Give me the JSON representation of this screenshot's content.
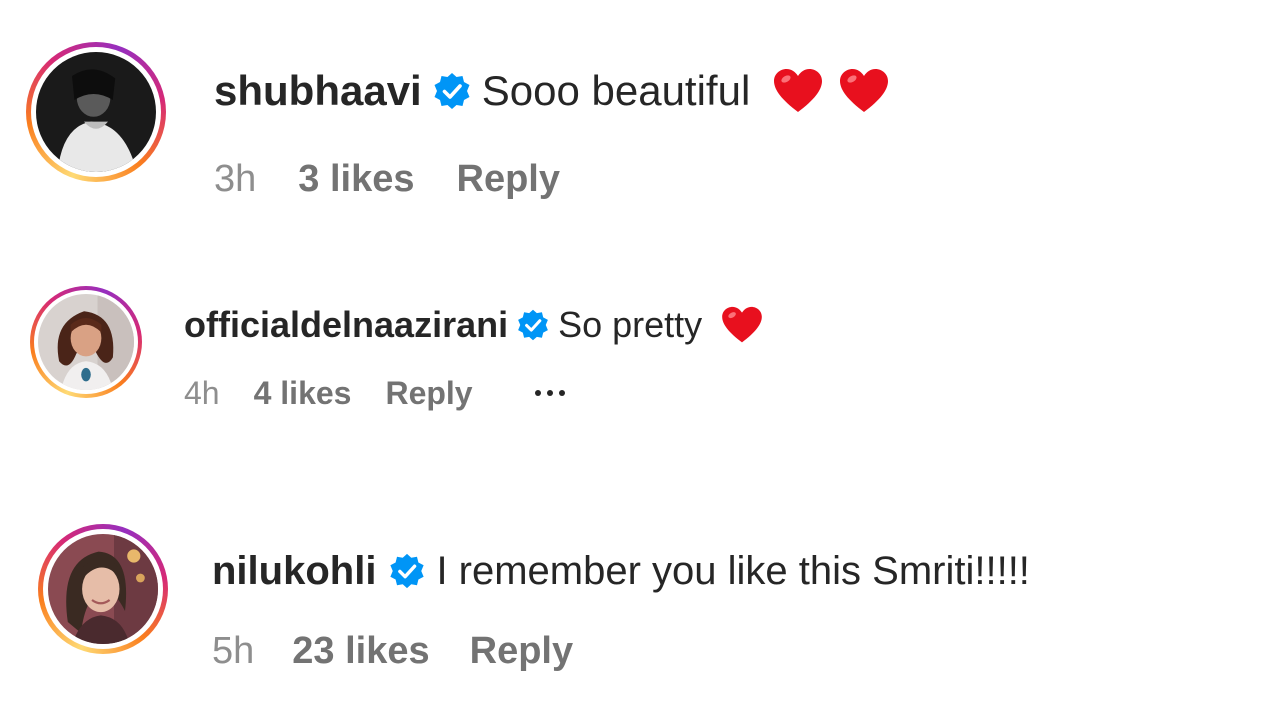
{
  "comments": [
    {
      "username": "shubhaavi",
      "text": "Sooo beautiful",
      "hearts": 2,
      "time": "3h",
      "likes": "3 likes",
      "reply": "Reply",
      "verified": true
    },
    {
      "username": "officialdelnaazirani",
      "text": "So pretty",
      "hearts": 1,
      "time": "4h",
      "likes": "4 likes",
      "reply": "Reply",
      "verified": true,
      "has_more": true
    },
    {
      "username": "nilukohli",
      "text": "I remember you like this Smriti!!!!!",
      "hearts": 0,
      "time": "5h",
      "likes": "23 likes",
      "reply": "Reply",
      "verified": true
    }
  ],
  "colors": {
    "verified_blue": "#0095f6",
    "heart_red": "#ed1c24",
    "secondary_text": "#737373"
  },
  "icons": {
    "verified": "verified-badge-icon",
    "heart": "red-heart-icon",
    "more": "more-options-icon"
  }
}
